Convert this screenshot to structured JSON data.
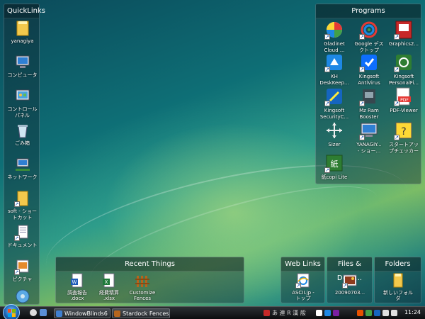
{
  "quicklinks": {
    "title": "QuickLinks",
    "items": [
      {
        "label": "yanagiya",
        "icon": "folder-icon"
      },
      {
        "label": "コンピュータ",
        "icon": "computer-icon"
      },
      {
        "label": "コントロール\nパネル",
        "icon": "control-panel-icon"
      },
      {
        "label": "ごみ箱",
        "icon": "recycle-bin-icon"
      },
      {
        "label": "ネットワーク",
        "icon": "network-icon"
      },
      {
        "label": "soft - ショー\nトカット",
        "icon": "folder-shortcut-icon"
      },
      {
        "label": "ドキュメント",
        "icon": "documents-icon"
      },
      {
        "label": "ピクチャ",
        "icon": "pictures-icon"
      },
      {
        "label": "",
        "icon": "music-icon"
      }
    ]
  },
  "programs": {
    "title": "Programs",
    "items": [
      {
        "label": "Gladinet\nCloud ...",
        "icon": "gladinet-icon"
      },
      {
        "label": "Google デス\nクトップ",
        "icon": "google-desktop-icon"
      },
      {
        "label": "Graphics2...",
        "icon": "graphics-icon"
      },
      {
        "label": "KH\nDeskKeep...",
        "icon": "kh-deskkeeper-icon"
      },
      {
        "label": "Kingsoft\nAntiVirus",
        "icon": "kingsoft-antivirus-icon"
      },
      {
        "label": "Kingsoft\nPersonalFi...",
        "icon": "kingsoft-firewall-icon"
      },
      {
        "label": "Kingsoft\nSecurityC...",
        "icon": "kingsoft-security-icon"
      },
      {
        "label": "Mz Ram\nBooster",
        "icon": "mz-ram-icon"
      },
      {
        "label": "PDF-Viewer",
        "icon": "pdf-viewer-icon"
      },
      {
        "label": "Sizer",
        "icon": "sizer-icon"
      },
      {
        "label": "YANAGIY...\n- ショー...",
        "icon": "computer-shortcut-icon"
      },
      {
        "label": "スタートアッ\nプチェッカー",
        "icon": "startup-checker-icon"
      },
      {
        "label": "紙copi Lite",
        "icon": "kamicopi-icon"
      }
    ]
  },
  "recent": {
    "title": "Recent Things",
    "items": [
      {
        "label": "調査報告\n.docx",
        "icon": "word-doc-icon"
      },
      {
        "label": "経費精算\n.xlsx",
        "icon": "excel-doc-icon"
      },
      {
        "label": "Customize\nFences",
        "icon": "fences-icon"
      }
    ]
  },
  "weblinks": {
    "title": "Web Links",
    "items": [
      {
        "label": "ASCII.jp -\nトップ",
        "icon": "ie-icon"
      }
    ]
  },
  "filesdocs": {
    "title": "Files & Docu...",
    "items": [
      {
        "label": "20090703...",
        "icon": "image-file-icon"
      }
    ]
  },
  "folders": {
    "title": "Folders",
    "items": [
      {
        "label": "新しいフォル\nダ",
        "icon": "folder-icon"
      }
    ]
  },
  "taskbar": {
    "buttons": [
      {
        "label": "WindowBlinds6",
        "icon": "windowblinds-icon"
      },
      {
        "label": "Stardock Fences™",
        "icon": "fences-icon"
      }
    ],
    "tray_text": "あ 連 R 漢 般",
    "clock": "11:24"
  }
}
